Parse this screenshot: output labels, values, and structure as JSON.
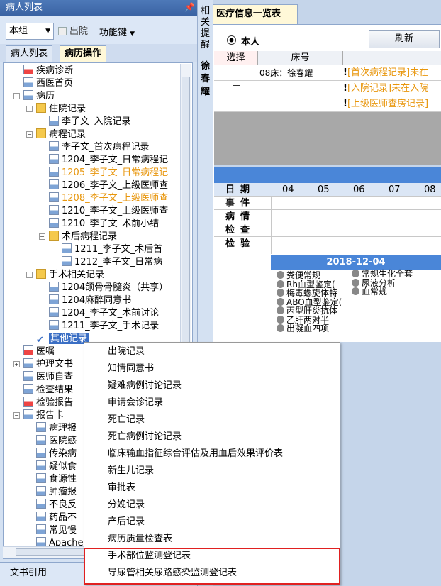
{
  "left_panel": {
    "title": "病人列表",
    "pin": "ㅁ",
    "scope_select": "本组",
    "discharge_label": "出院",
    "function_keys": "功能键",
    "tabs": [
      "病人列表",
      "病历操作"
    ],
    "bottom_label": "文书引用"
  },
  "tree": [
    {
      "label": "疾病诊断"
    },
    {
      "label": "西医首页"
    },
    {
      "label": "病历"
    },
    {
      "label": "住院记录"
    },
    {
      "label": "李子文_入院记录"
    },
    {
      "label": "病程记录"
    },
    {
      "label": "李子文_首次病程记录"
    },
    {
      "label": "1204_李子文_日常病程记"
    },
    {
      "label": "1205_李子文_日常病程记"
    },
    {
      "label": "1206_李子文_上级医师查"
    },
    {
      "label": "1208_李子文_上级医师查"
    },
    {
      "label": "1210_李子文_上级医师查"
    },
    {
      "label": "1210_李子文_术前小结"
    },
    {
      "label": "术后病程记录"
    },
    {
      "label": "1211_李子文_术后首"
    },
    {
      "label": "1212_李子文_日常病"
    },
    {
      "label": "手术相关记录"
    },
    {
      "label": "1204颌骨骨髓炎（共享）"
    },
    {
      "label": "1204麻醉同意书"
    },
    {
      "label": "1204_李子文_术前讨论"
    },
    {
      "label": "1211_李子文_手术记录"
    },
    {
      "label": "其他记录"
    },
    {
      "label": "医嘱"
    },
    {
      "label": "护理文书"
    },
    {
      "label": "医师自查"
    },
    {
      "label": "检查结果"
    },
    {
      "label": "检验报告"
    },
    {
      "label": "报告卡"
    },
    {
      "label": "病理报"
    },
    {
      "label": "医院感"
    },
    {
      "label": "传染病"
    },
    {
      "label": "疑似食"
    },
    {
      "label": "食源性"
    },
    {
      "label": "肿瘤报"
    },
    {
      "label": "不良反"
    },
    {
      "label": "药品不"
    },
    {
      "label": "常见慢"
    },
    {
      "label": "Apache"
    }
  ],
  "mid_strip": {
    "top_chars": [
      "相",
      "关",
      "提",
      "醒"
    ],
    "bottom_chars": [
      "徐",
      "春",
      "耀"
    ]
  },
  "right_panel": {
    "tab": "医疗信息一览表",
    "radio_label": "本人",
    "refresh_button": "刷新",
    "grid_headers": [
      "选择",
      "床号"
    ],
    "grid_rows": [
      {
        "bed": "08床：徐春耀",
        "note": "[首次病程记录]未在"
      },
      {
        "bed": "",
        "note": "[入院记录]未在入院"
      },
      {
        "bed": "",
        "note": "[上级医师查房记录]"
      }
    ],
    "cal_labels": [
      "日期",
      "事件",
      "病情",
      "检查",
      "检验"
    ],
    "cal_days": [
      "04",
      "05",
      "06",
      "07",
      "08"
    ],
    "date": "2018-12-04",
    "lab_col1": [
      "粪便常规",
      "Rh血型鉴定(",
      "梅毒螺旋体特",
      "ABO血型鉴定(",
      "丙型肝炎抗体",
      "乙肝两对半",
      "出凝血四项"
    ],
    "lab_col2": [
      "常规生化全套",
      "尿液分析",
      "血常规"
    ]
  },
  "context_menu": {
    "items": [
      "出院记录",
      "知情同意书",
      "疑难病例讨论记录",
      "申请会诊记录",
      "死亡记录",
      "死亡病例讨论记录",
      "临床输血指征综合评估及用血后效果评价表",
      "新生儿记录",
      "审批表",
      "分娩记录",
      "产后记录",
      "病历质量检查表",
      "手术部位监测登记表",
      "导尿管相关尿路感染监测登记表"
    ]
  },
  "colors": {
    "accent_blue": "#3a63a3",
    "highlight_orange": "#e8960c",
    "selection_box_red": "#e02020"
  }
}
